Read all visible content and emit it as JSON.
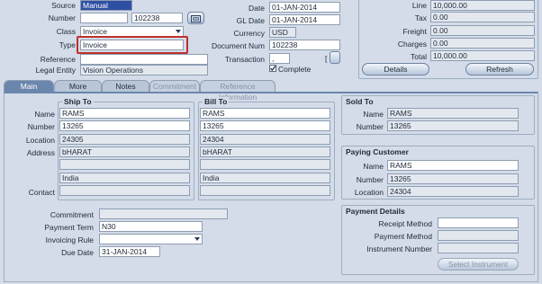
{
  "header": {
    "source": {
      "label": "Source",
      "value": "Manual"
    },
    "number": {
      "label": "Number",
      "value": "",
      "value2": "102238"
    },
    "class": {
      "label": "Class",
      "value": "Invoice"
    },
    "type": {
      "label": "Type",
      "value": "Invoice"
    },
    "reference": {
      "label": "Reference",
      "value": ""
    },
    "legal_entity": {
      "label": "Legal Entity",
      "value": "Vision Operations"
    },
    "date": {
      "label": "Date",
      "value": "01-JAN-2014"
    },
    "gl_date": {
      "label": "GL Date",
      "value": "01-JAN-2014"
    },
    "currency": {
      "label": "Currency",
      "value": "USD"
    },
    "document_num": {
      "label": "Document Num",
      "value": "102238"
    },
    "transaction": {
      "label": "Transaction",
      "value": ",",
      "bracket_left": "[",
      "bracket_right": "]"
    },
    "complete": {
      "label": "Complete",
      "checked": true
    }
  },
  "totals": {
    "line": {
      "label": "Line",
      "value": "10,000.00"
    },
    "tax": {
      "label": "Tax",
      "value": "0.00"
    },
    "freight": {
      "label": "Freight",
      "value": "0.00"
    },
    "charges": {
      "label": "Charges",
      "value": "0.00"
    },
    "total": {
      "label": "Total",
      "value": "10,000.00"
    },
    "details_button": "Details",
    "refresh_button": "Refresh"
  },
  "tabs": [
    {
      "label": "Main",
      "state": "active"
    },
    {
      "label": "More",
      "state": "normal"
    },
    {
      "label": "Notes",
      "state": "normal"
    },
    {
      "label": "Commitment",
      "state": "disabled"
    },
    {
      "label": "Reference Information",
      "state": "disabled"
    }
  ],
  "ship_to": {
    "title": "Ship To",
    "name": "RAMS",
    "number": "13265",
    "location": "24305",
    "address1": "bHARAT",
    "address2": "",
    "address3": "India",
    "address4": "",
    "contact": ""
  },
  "bill_to": {
    "title": "Bill To",
    "name": "RAMS",
    "number": "13265",
    "location": "24304",
    "address1": "bHARAT",
    "address2": "",
    "address3": "India",
    "address4": "",
    "contact": ""
  },
  "address_labels": {
    "name": "Name",
    "number": "Number",
    "location": "Location",
    "address": "Address",
    "contact": "Contact"
  },
  "sold_to": {
    "title": "Sold To",
    "name_label": "Name",
    "name": "RAMS",
    "number_label": "Number",
    "number": "13265"
  },
  "paying_customer": {
    "title": "Paying Customer",
    "name_label": "Name",
    "name": "RAMS",
    "number_label": "Number",
    "number": "13265",
    "location_label": "Location",
    "location": "24304"
  },
  "terms": {
    "commitment": {
      "label": "Commitment",
      "value": ""
    },
    "payment_term": {
      "label": "Payment Term",
      "value": "N30"
    },
    "invoicing_rule": {
      "label": "Invoicing Rule",
      "value": ""
    },
    "due_date": {
      "label": "Due Date",
      "value": "31-JAN-2014"
    }
  },
  "payment_details": {
    "title": "Payment Details",
    "receipt_method": {
      "label": "Receipt Method",
      "value": ""
    },
    "payment_method": {
      "label": "Payment Method",
      "value": ""
    },
    "instrument_number": {
      "label": "Instrument Number",
      "value": ""
    },
    "select_instrument_button": "Select Instrument"
  },
  "colors": {
    "highlight": "#c0302b",
    "active_tab": "#6b86ad",
    "selected_field": "#2f4fa3"
  }
}
